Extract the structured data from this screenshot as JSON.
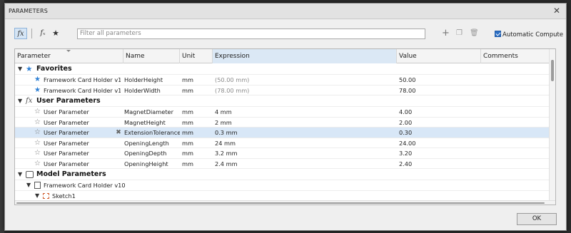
{
  "dialog": {
    "title": "PARAMETERS",
    "close_glyph": "✕"
  },
  "toolbar": {
    "fx_label": "fx",
    "fx_filter_label": "fₓ",
    "star_label": "★",
    "search_placeholder": "Filter all parameters",
    "add_glyph": "+",
    "copy_glyph": "❐",
    "delete_glyph": "🗑",
    "auto_compute_label": "Automatic Compute",
    "auto_compute_checked": true
  },
  "table": {
    "headers": {
      "parameter": "Parameter",
      "name": "Name",
      "unit": "Unit",
      "expression": "Expression",
      "value": "Value",
      "comments": "Comments"
    },
    "favorites": {
      "label": "Favorites",
      "rows": [
        {
          "parameter": "Framework Card Holder v1...",
          "name": "HolderHeight",
          "unit": "mm",
          "expression": "(50.00 mm)",
          "value": "50.00"
        },
        {
          "parameter": "Framework Card Holder v1...",
          "name": "HolderWidth",
          "unit": "mm",
          "expression": "(78.00 mm)",
          "value": "78.00"
        }
      ]
    },
    "user_parameters": {
      "label": "User Parameters",
      "rows": [
        {
          "parameter": "User Parameter",
          "name": "MagnetDiameter",
          "unit": "mm",
          "expression": "4 mm",
          "value": "4.00"
        },
        {
          "parameter": "User Parameter",
          "name": "MagnetHeight",
          "unit": "mm",
          "expression": "2 mm",
          "value": "2.00"
        },
        {
          "parameter": "User Parameter",
          "name": "ExtensionTolerance",
          "unit": "mm",
          "expression": "0.3 mm",
          "value": "0.30",
          "delete_glyph": "✖"
        },
        {
          "parameter": "User Parameter",
          "name": "OpeningLength",
          "unit": "mm",
          "expression": "24 mm",
          "value": "24.00"
        },
        {
          "parameter": "User Parameter",
          "name": "OpeningDepth",
          "unit": "mm",
          "expression": "3.2 mm",
          "value": "3.20"
        },
        {
          "parameter": "User Parameter",
          "name": "OpeningHeight",
          "unit": "mm",
          "expression": "2.4 mm",
          "value": "2.40"
        }
      ]
    },
    "model_parameters": {
      "label": "Model Parameters",
      "document": "Framework Card Holder v10",
      "sketch": "Sketch1"
    }
  },
  "footer": {
    "ok_label": "OK"
  }
}
